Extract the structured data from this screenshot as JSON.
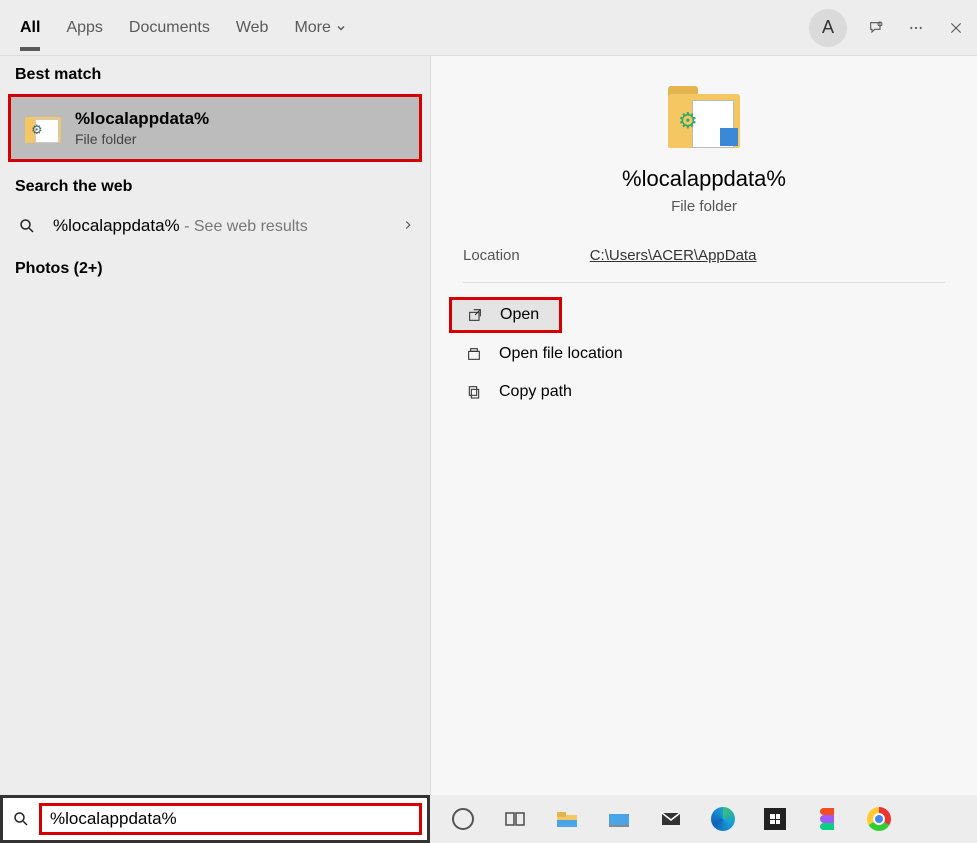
{
  "tabs": {
    "all": "All",
    "apps": "Apps",
    "documents": "Documents",
    "web": "Web",
    "more": "More"
  },
  "avatar_letter": "A",
  "left": {
    "best_match": "Best match",
    "result_primary": "%localappdata%",
    "result_secondary": "File folder",
    "search_the_web": "Search the web",
    "web_query": "%localappdata%",
    "web_suffix": " - See web results",
    "photos": "Photos (2+)"
  },
  "preview": {
    "title": "%localappdata%",
    "subtitle": "File folder",
    "location_label": "Location",
    "location_value": "C:\\Users\\ACER\\AppData",
    "actions": {
      "open": "Open",
      "open_file_location": "Open file location",
      "copy_path": "Copy path"
    }
  },
  "search": {
    "value": "%localappdata%"
  }
}
